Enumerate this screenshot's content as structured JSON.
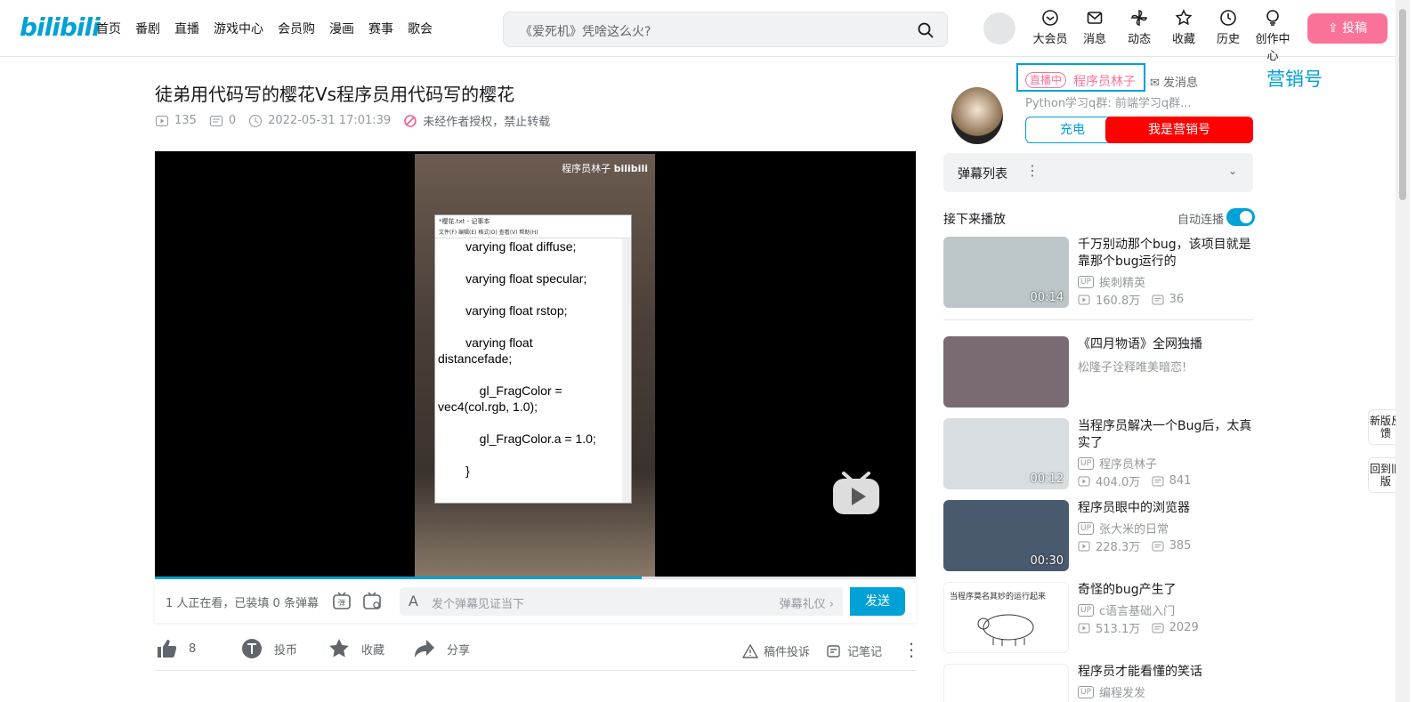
{
  "header": {
    "logo": "bilibili",
    "nav": [
      "首页",
      "番剧",
      "直播",
      "游戏中心",
      "会员购",
      "漫画",
      "赛事",
      "歌会"
    ],
    "search_placeholder": "《爱死机》凭啥这么火?",
    "icons": [
      {
        "label": "大会员",
        "icon": "vip-icon"
      },
      {
        "label": "消息",
        "icon": "mail-icon"
      },
      {
        "label": "动态",
        "icon": "windmill-icon"
      },
      {
        "label": "收藏",
        "icon": "star-icon"
      },
      {
        "label": "历史",
        "icon": "clock-icon"
      },
      {
        "label": "创作中心",
        "icon": "bulb-icon"
      }
    ],
    "upload_label": "投稿"
  },
  "video": {
    "title": "徒弟用代码写的樱花Vs程序员用代码写的樱花",
    "views": "135",
    "danmaku_count": "0",
    "date": "2022-05-31 17:01:39",
    "copyright": "未经作者授权，禁止转载",
    "watermark": "程序员林子",
    "notepad_title": "*樱花.txt - 记事本",
    "notepad_menu": "文件(F)   编辑(E)   格式(O)   查看(V)   帮助(H)",
    "notepad_code": "        varying float diffuse;\n\n        varying float specular;\n\n        varying float rstop;\n\n        varying float\ndistancefade;\n\n            gl_FragColor =\nvec4(col.rgb, 1.0);\n\n            gl_FragColor.a = 1.0;\n\n        }",
    "progress": 0.64
  },
  "sendbar": {
    "viewers": "1 人正在看，已装填 0 条弹幕",
    "placeholder": "发个弹幕见证当下",
    "gift": "弹幕礼仪 ›",
    "send": "发送"
  },
  "toolbar": {
    "likes": "8",
    "coin": "投币",
    "fav": "收藏",
    "share": "分享",
    "report": "稿件投诉",
    "notes": "记笔记"
  },
  "up": {
    "live_badge": "直播中",
    "name": "程序员林子",
    "message": "发消息",
    "marketing": "营销号",
    "desc": "Python学习q群:            前端学习q群...",
    "charge": "充电",
    "follow": "我是营销号"
  },
  "danmaku_list": {
    "title": "弹幕列表"
  },
  "next": {
    "title": "接下来播放",
    "autoplay": "自动连播",
    "items": [
      {
        "title": "千万别动那个bug，该项目就是靠那个bug运行的",
        "author": "挨刺精英",
        "views": "160.8万",
        "danmaku": "36",
        "duration": "00:14",
        "color": "#bcc6c8"
      },
      {
        "title": "《四月物语》全网独播",
        "ad": "松隆子诠释唯美暗恋!",
        "color": "#7a6a74"
      },
      {
        "title": "当程序员解决一个Bug后，太真实了",
        "author": "程序员林子",
        "views": "404.0万",
        "danmaku": "841",
        "duration": "00:12",
        "color": "#d8dde2"
      },
      {
        "title": "程序员眼中的浏览器",
        "author": "张大米的日常",
        "views": "228.3万",
        "danmaku": "385",
        "duration": "00:30",
        "color": "#4a5a6e"
      },
      {
        "title": "奇怪的bug产生了",
        "author": "c语言基础入门",
        "views": "513.1万",
        "danmaku": "2029",
        "thumb_text": "当程序莫名其妙的运行起来",
        "color": "#ffffff"
      },
      {
        "title": "程序员才能看懂的笑话",
        "author": "编程发发",
        "color": "#ffffff"
      }
    ]
  },
  "side": {
    "feedback": "新版反馈",
    "back": "回到旧版"
  }
}
